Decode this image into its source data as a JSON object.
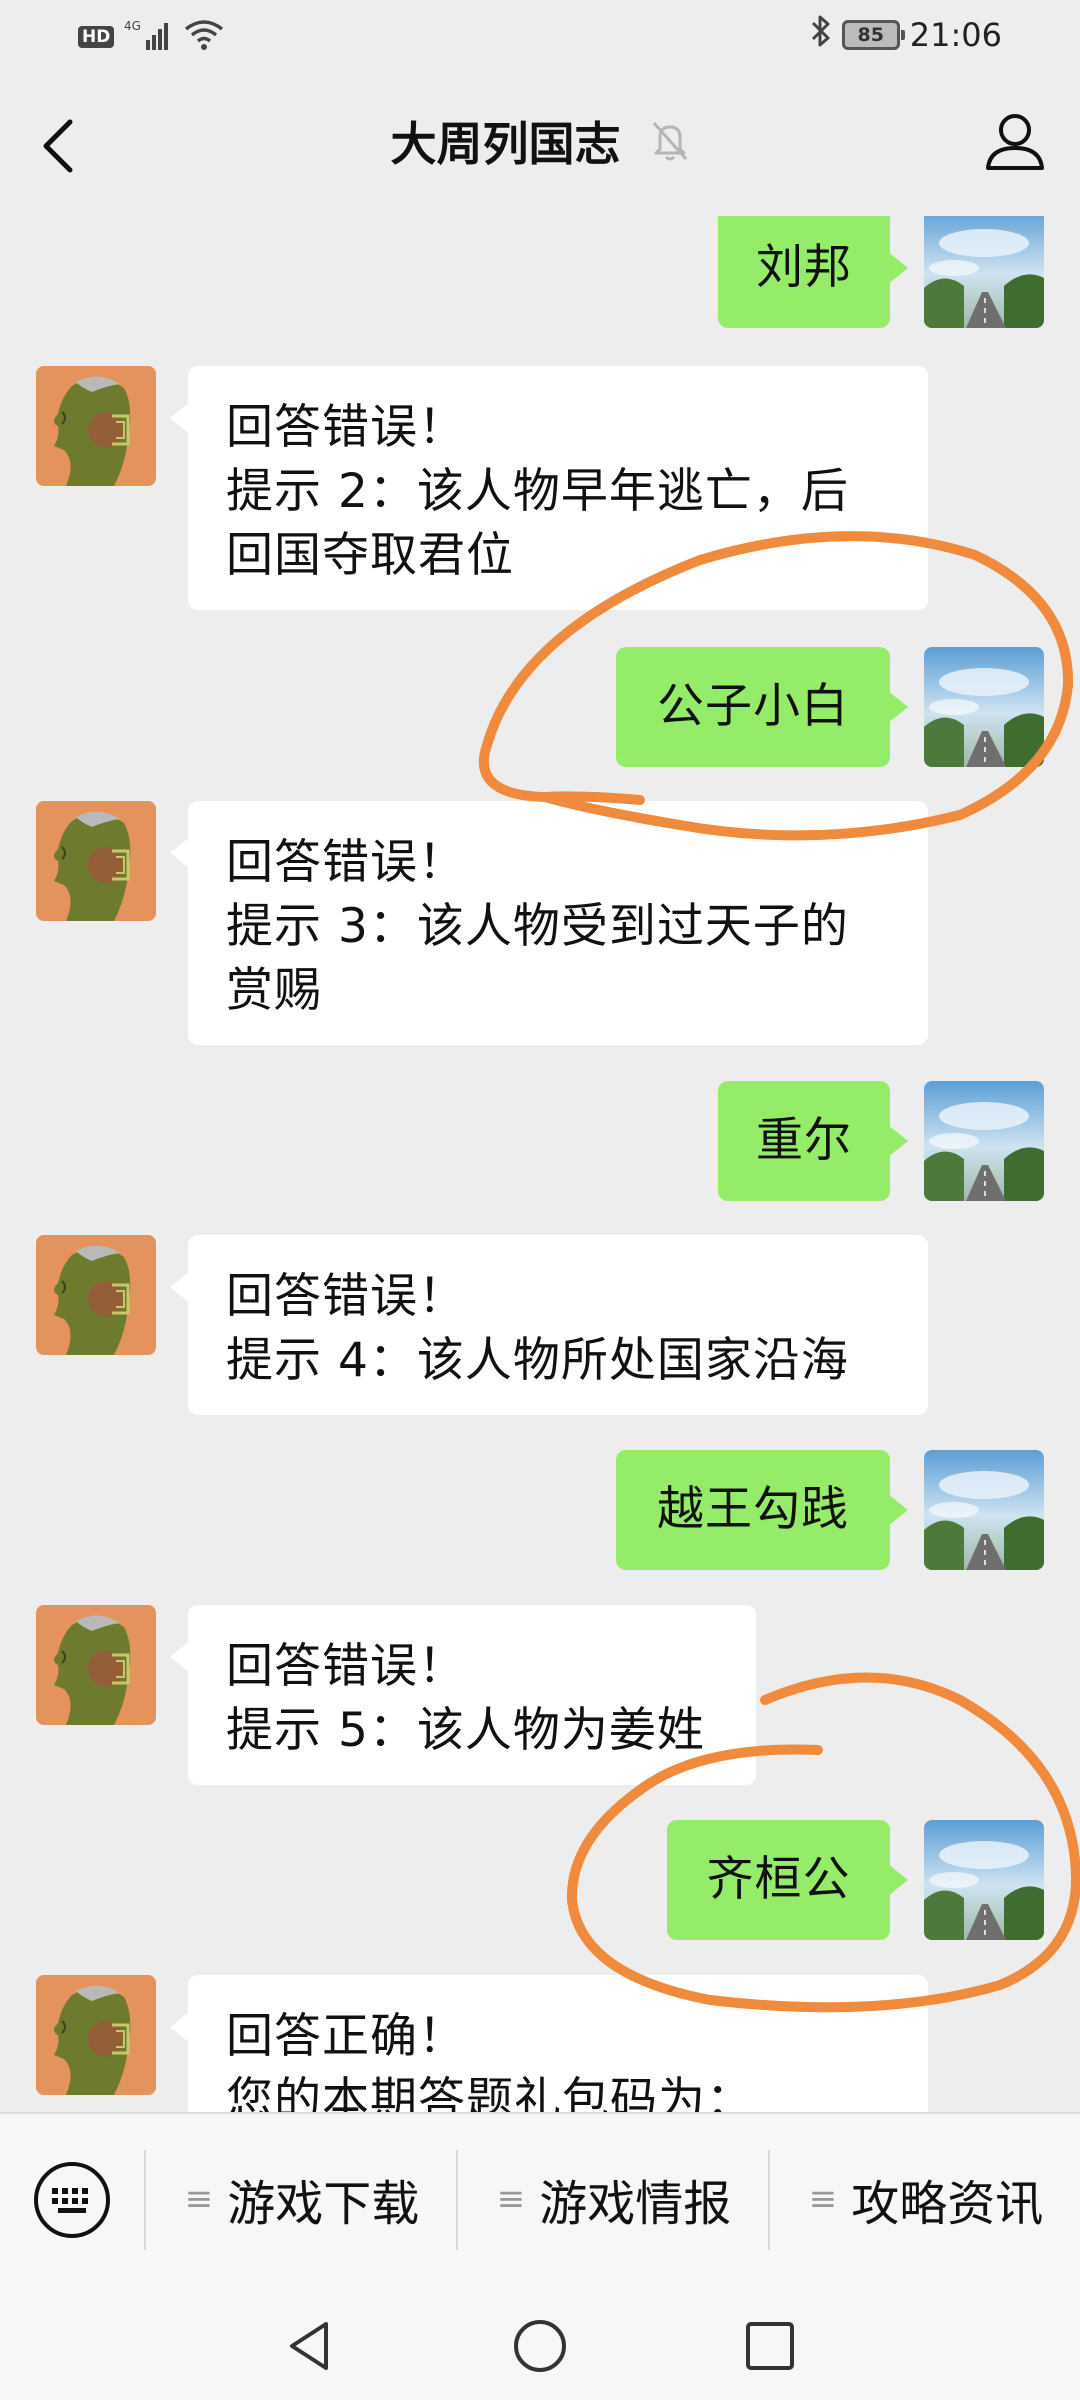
{
  "status_bar": {
    "hd_badge": "HD",
    "network": "4G",
    "battery": "85",
    "time": "21:06"
  },
  "header": {
    "title": "大周列国志",
    "back_icon": "chevron-left-icon",
    "mute_icon": "bell-muted-icon",
    "profile_icon": "person-icon"
  },
  "messages": [
    {
      "sender": "me",
      "text": "刘邦"
    },
    {
      "sender": "bot",
      "lines": [
        "回答错误！",
        "提示 2：该人物早年逃亡，后",
        "回国夺取君位"
      ]
    },
    {
      "sender": "me",
      "text": "公子小白"
    },
    {
      "sender": "bot",
      "lines": [
        "回答错误！",
        "提示 3：该人物受到过天子的",
        "赏赐"
      ]
    },
    {
      "sender": "me",
      "text": "重尔"
    },
    {
      "sender": "bot",
      "lines": [
        "回答错误！",
        "提示 4：该人物所处国家沿海"
      ]
    },
    {
      "sender": "me",
      "text": "越王勾践"
    },
    {
      "sender": "bot",
      "lines": [
        "回答错误！",
        "提示 5：该人物为姜姓"
      ]
    },
    {
      "sender": "me",
      "text": "齐桓公"
    },
    {
      "sender": "bot",
      "lines": [
        "回答正确！",
        "您的本期答题礼包码为："
      ]
    }
  ],
  "menu": {
    "keyboard_icon": "keyboard-icon",
    "items": [
      {
        "label": "游戏下载",
        "icon": "menu-lines-icon"
      },
      {
        "label": "游戏情报",
        "icon": "menu-lines-icon"
      },
      {
        "label": "攻略资讯",
        "icon": "menu-lines-icon"
      }
    ]
  },
  "nav": {
    "back": "triangle-back-icon",
    "home": "circle-home-icon",
    "recents": "square-recents-icon"
  },
  "colors": {
    "background": "#ededed",
    "my_bubble": "#95ec69",
    "bot_bubble": "#ffffff",
    "annotation": "#f08a3c"
  }
}
